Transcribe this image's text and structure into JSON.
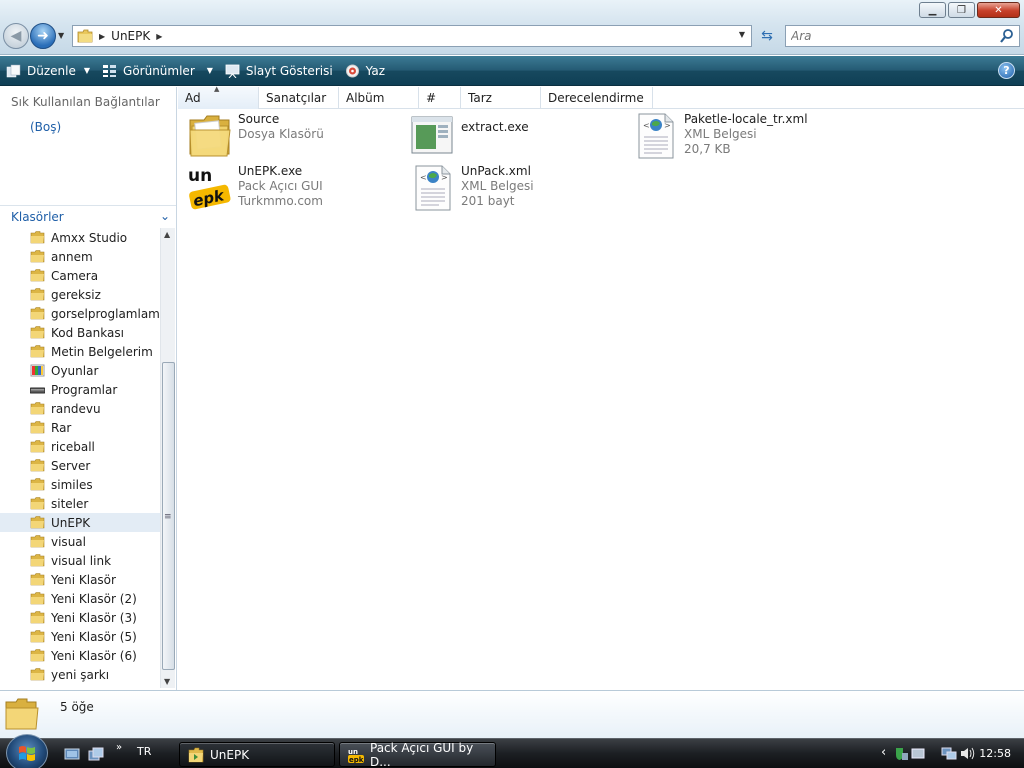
{
  "window": {
    "title_buttons": [
      "minimize",
      "maximize",
      "close"
    ]
  },
  "address": {
    "crumbs": [
      "UnEPK"
    ],
    "search_placeholder": "Ara"
  },
  "commands": [
    {
      "label": "Düzenle",
      "icon": "organize-icon",
      "has_menu": true
    },
    {
      "label": "Görünümler",
      "icon": "views-icon",
      "has_menu": true
    },
    {
      "label": "Slayt Gösterisi",
      "icon": "slideshow-icon",
      "has_menu": false
    },
    {
      "label": "Yaz",
      "icon": "burn-icon",
      "has_menu": false
    }
  ],
  "nav": {
    "favorites_title": "Sık Kullanılan Bağlantılar",
    "favorites_empty": "(Boş)",
    "folders_title": "Klasörler",
    "tree": [
      {
        "label": "Amxx Studio",
        "icon": "folder"
      },
      {
        "label": "annem",
        "icon": "folder"
      },
      {
        "label": "Camera",
        "icon": "folder"
      },
      {
        "label": "gereksiz",
        "icon": "folder"
      },
      {
        "label": "gorselproglamlama",
        "icon": "folder"
      },
      {
        "label": "Kod Bankası",
        "icon": "folder"
      },
      {
        "label": "Metin Belgelerim",
        "icon": "folder"
      },
      {
        "label": "Oyunlar",
        "icon": "games"
      },
      {
        "label": "Programlar",
        "icon": "drive"
      },
      {
        "label": "randevu",
        "icon": "folder"
      },
      {
        "label": "Rar",
        "icon": "folder"
      },
      {
        "label": "riceball",
        "icon": "folder"
      },
      {
        "label": "Server",
        "icon": "folder"
      },
      {
        "label": "similes",
        "icon": "folder"
      },
      {
        "label": "siteler",
        "icon": "folder"
      },
      {
        "label": "UnEPK",
        "icon": "folder",
        "selected": true
      },
      {
        "label": "visual",
        "icon": "folder"
      },
      {
        "label": "visual link",
        "icon": "folder"
      },
      {
        "label": "Yeni Klasör",
        "icon": "folder"
      },
      {
        "label": "Yeni Klasör (2)",
        "icon": "folder"
      },
      {
        "label": "Yeni Klasör (3)",
        "icon": "folder"
      },
      {
        "label": "Yeni Klasör (5)",
        "icon": "folder"
      },
      {
        "label": "Yeni Klasör (6)",
        "icon": "folder"
      },
      {
        "label": "yeni şarkı",
        "icon": "folder"
      }
    ]
  },
  "columns": [
    "Ad",
    "Sanatçılar",
    "Albüm",
    "#",
    "Tarz",
    "Derecelendirme"
  ],
  "files": [
    {
      "name": "Source",
      "line2": "Dosya Klasörü",
      "line3": "",
      "icon": "folder"
    },
    {
      "name": "extract.exe",
      "line2": "",
      "line3": "",
      "icon": "exe"
    },
    {
      "name": "Paketle-locale_tr.xml",
      "line2": "XML Belgesi",
      "line3": "20,7 KB",
      "icon": "xml"
    },
    {
      "name": "UnEPK.exe",
      "line2": "Pack Açıcı GUI",
      "line3": "Turkmmo.com",
      "icon": "unepk-logo"
    },
    {
      "name": "UnPack.xml",
      "line2": "XML Belgesi",
      "line3": "201 bayt",
      "icon": "xml"
    }
  ],
  "details": {
    "count": "5 öğe"
  },
  "taskbar": {
    "lang": "TR",
    "tasks": [
      {
        "label": "UnEPK",
        "icon": "folder",
        "active": true
      },
      {
        "label": "Pack Açıcı GUI by D...",
        "icon": "unepk-logo",
        "active": false
      }
    ],
    "clock": "12:58"
  }
}
